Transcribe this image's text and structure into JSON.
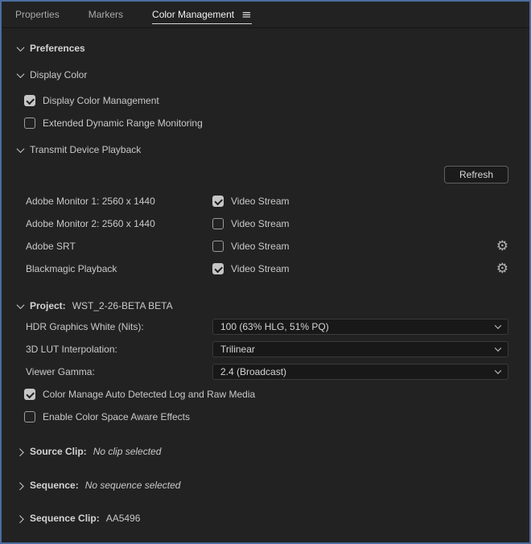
{
  "colors": {
    "panel_background": "#222222",
    "focus_border": "#4a6d9e",
    "text": "#c9c9c9",
    "active_tab_text": "#f2f2f2",
    "active_tab_underline": "#d6d6d6",
    "checkbox_checked_fill": "#c6c6c6",
    "control_background": "#181818",
    "control_border": "#3a3a3a",
    "button_border": "#606060"
  },
  "icons": {
    "panel_menu": "≡",
    "gear": "⚙"
  },
  "tabs": [
    {
      "label": "Properties",
      "active": false
    },
    {
      "label": "Markers",
      "active": false
    },
    {
      "label": "Color Management",
      "active": true
    }
  ],
  "preferences": {
    "label": "Preferences"
  },
  "display_color": {
    "label": "Display Color",
    "checkboxes": [
      {
        "label": "Display Color Management",
        "checked": true
      },
      {
        "label": "Extended Dynamic Range Monitoring",
        "checked": false
      }
    ]
  },
  "transmit": {
    "label": "Transmit Device Playback",
    "refresh_button": "Refresh",
    "devices": [
      {
        "name": "Adobe Monitor 1: 2560 x 1440",
        "stream_label": "Video Stream",
        "checked": true,
        "gear": false
      },
      {
        "name": "Adobe Monitor 2: 2560 x 1440",
        "stream_label": "Video Stream",
        "checked": false,
        "gear": false
      },
      {
        "name": "Adobe SRT",
        "stream_label": "Video Stream",
        "checked": false,
        "gear": true
      },
      {
        "name": "Blackmagic Playback",
        "stream_label": "Video Stream",
        "checked": true,
        "gear": true
      }
    ]
  },
  "project": {
    "label": "Project:",
    "value": "WST_2-26-BETA BETA",
    "fields": [
      {
        "label": "HDR Graphics White (Nits):",
        "value": "100 (63% HLG, 51% PQ)"
      },
      {
        "label": "3D LUT Interpolation:",
        "value": "Trilinear"
      },
      {
        "label": "Viewer Gamma:",
        "value": "2.4 (Broadcast)"
      }
    ],
    "checkboxes": [
      {
        "label": "Color Manage Auto Detected Log and Raw Media",
        "checked": true
      },
      {
        "label": "Enable Color Space Aware Effects",
        "checked": false
      }
    ]
  },
  "source_clip": {
    "label": "Source Clip:",
    "value": "No clip selected"
  },
  "sequence": {
    "label": "Sequence:",
    "value": "No sequence selected"
  },
  "sequence_clip": {
    "label": "Sequence Clip:",
    "value": "AA5496"
  }
}
